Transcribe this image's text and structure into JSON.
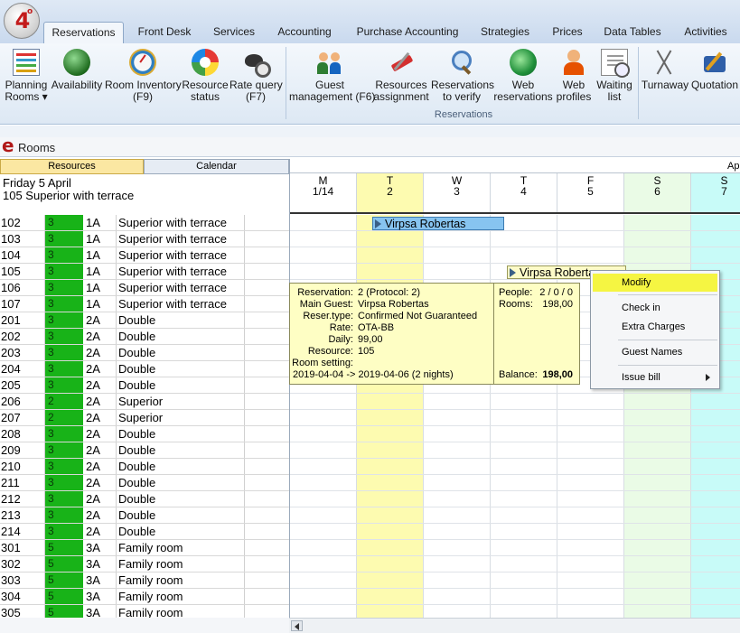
{
  "app": {
    "logo_text": "4",
    "logo_sup": "o"
  },
  "tabs": [
    {
      "label": "Reservations",
      "active": true
    },
    {
      "label": "Front Desk"
    },
    {
      "label": "Services"
    },
    {
      "label": "Accounting"
    },
    {
      "label": "Purchase Accounting"
    },
    {
      "label": "Strategies"
    },
    {
      "label": "Prices"
    },
    {
      "label": "Data Tables"
    },
    {
      "label": "Activities"
    }
  ],
  "ribbon": {
    "buttons": [
      {
        "l1": "Planning",
        "l2": "Rooms ▾",
        "icon": "planning-icon"
      },
      {
        "l1": "Availability",
        "l2": "",
        "icon": "globe-icon"
      },
      {
        "l1": "Room Inventory",
        "l2": "(F9)",
        "icon": "gauge-icon"
      },
      {
        "l1": "Resource",
        "l2": "status",
        "icon": "color-wheel-icon"
      },
      {
        "l1": "Rate query",
        "l2": "(F7)",
        "icon": "detective-icon"
      },
      {
        "l1": "Guest",
        "l2": "management (F6)",
        "icon": "people-icon"
      },
      {
        "l1": "Resources",
        "l2": "assignment",
        "icon": "tool-icon"
      },
      {
        "l1": "Reservations",
        "l2": "to verify",
        "icon": "magnifier-icon"
      },
      {
        "l1": "Web",
        "l2": "reservations",
        "icon": "recycle-globe-icon"
      },
      {
        "l1": "Web",
        "l2": "profiles",
        "icon": "person-icon"
      },
      {
        "l1": "Waiting",
        "l2": "list",
        "icon": "clock-list-icon"
      },
      {
        "l1": "Turnaway",
        "l2": "",
        "icon": "scissors-icon"
      },
      {
        "l1": "Quotation",
        "l2": "",
        "icon": "pen-icon"
      }
    ],
    "group_label": "Reservations"
  },
  "title_strip": {
    "icon_letter": "e",
    "title": "Rooms"
  },
  "left_panel": {
    "tab_resources": "Resources",
    "tab_calendar": "Calendar",
    "date": "Friday 5 April",
    "room": "105 Superior with terrace"
  },
  "rooms": [
    {
      "num": "102",
      "cap": "3",
      "type": "1A",
      "desc": "Superior with terrace"
    },
    {
      "num": "103",
      "cap": "3",
      "type": "1A",
      "desc": "Superior with terrace"
    },
    {
      "num": "104",
      "cap": "3",
      "type": "1A",
      "desc": "Superior with terrace"
    },
    {
      "num": "105",
      "cap": "3",
      "type": "1A",
      "desc": "Superior with terrace"
    },
    {
      "num": "106",
      "cap": "3",
      "type": "1A",
      "desc": "Superior with terrace"
    },
    {
      "num": "107",
      "cap": "3",
      "type": "1A",
      "desc": "Superior with terrace"
    },
    {
      "num": "201",
      "cap": "3",
      "type": "2A",
      "desc": "Double"
    },
    {
      "num": "202",
      "cap": "3",
      "type": "2A",
      "desc": "Double"
    },
    {
      "num": "203",
      "cap": "3",
      "type": "2A",
      "desc": "Double"
    },
    {
      "num": "204",
      "cap": "3",
      "type": "2A",
      "desc": "Double"
    },
    {
      "num": "205",
      "cap": "3",
      "type": "2A",
      "desc": "Double"
    },
    {
      "num": "206",
      "cap": "2",
      "type": "2A",
      "desc": "Superior"
    },
    {
      "num": "207",
      "cap": "2",
      "type": "2A",
      "desc": "Superior"
    },
    {
      "num": "208",
      "cap": "3",
      "type": "2A",
      "desc": "Double"
    },
    {
      "num": "209",
      "cap": "3",
      "type": "2A",
      "desc": "Double"
    },
    {
      "num": "210",
      "cap": "3",
      "type": "2A",
      "desc": "Double"
    },
    {
      "num": "211",
      "cap": "3",
      "type": "2A",
      "desc": "Double"
    },
    {
      "num": "212",
      "cap": "3",
      "type": "2A",
      "desc": "Double"
    },
    {
      "num": "213",
      "cap": "3",
      "type": "2A",
      "desc": "Double"
    },
    {
      "num": "214",
      "cap": "3",
      "type": "2A",
      "desc": "Double"
    },
    {
      "num": "301",
      "cap": "5",
      "type": "3A",
      "desc": "Family room"
    },
    {
      "num": "302",
      "cap": "5",
      "type": "3A",
      "desc": "Family room"
    },
    {
      "num": "303",
      "cap": "5",
      "type": "3A",
      "desc": "Family room"
    },
    {
      "num": "304",
      "cap": "5",
      "type": "3A",
      "desc": "Family room"
    },
    {
      "num": "305",
      "cap": "5",
      "type": "3A",
      "desc": "Family room"
    }
  ],
  "calendar": {
    "month_label": "Ap",
    "days": [
      {
        "dow": "M",
        "date": "1/14",
        "bg": "#ffffff"
      },
      {
        "dow": "T",
        "date": "2",
        "bg": "#fdfbb0"
      },
      {
        "dow": "W",
        "date": "3",
        "bg": "#ffffff"
      },
      {
        "dow": "T",
        "date": "4",
        "bg": "#ffffff"
      },
      {
        "dow": "F",
        "date": "5",
        "bg": "#ffffff"
      },
      {
        "dow": "S",
        "date": "6",
        "bg": "#eafbe6"
      },
      {
        "dow": "S",
        "date": "7",
        "bg": "#c8fbf8"
      }
    ],
    "bars": [
      {
        "guest": "Virpsa Robertas"
      },
      {
        "guest": "Virpsa Robertas"
      }
    ]
  },
  "tooltip": {
    "rows": [
      {
        "k": "Reservation:",
        "v": "2 (Protocol: 2)"
      },
      {
        "k": "Main Guest:",
        "v": "Virpsa Robertas"
      },
      {
        "k": "Reser.type:",
        "v": "Confirmed Not Guaranteed"
      },
      {
        "k": "Rate:",
        "v": "OTA-BB"
      },
      {
        "k": "Daily:",
        "v": "99,00"
      },
      {
        "k": "Resource:",
        "v": "105"
      },
      {
        "k": "Room setting:",
        "v": ""
      }
    ],
    "dates": "2019-04-04 -> 2019-04-06 (2 nights)",
    "people_label": "People:",
    "people_value": "2 / 0 / 0",
    "rooms_label": "Rooms:",
    "rooms_value": "198,00",
    "balance_label": "Balance:",
    "balance_value": "198,00"
  },
  "context_menu": {
    "modify": "Modify",
    "check_in": "Check in",
    "extra_charges": "Extra Charges",
    "guest_names": "Guest Names",
    "issue_bill": "Issue bill"
  },
  "colors": {
    "capacity_green": "#18b318",
    "highlight_yellow": "#f5f542",
    "bar_blue": "#87c4f0"
  }
}
